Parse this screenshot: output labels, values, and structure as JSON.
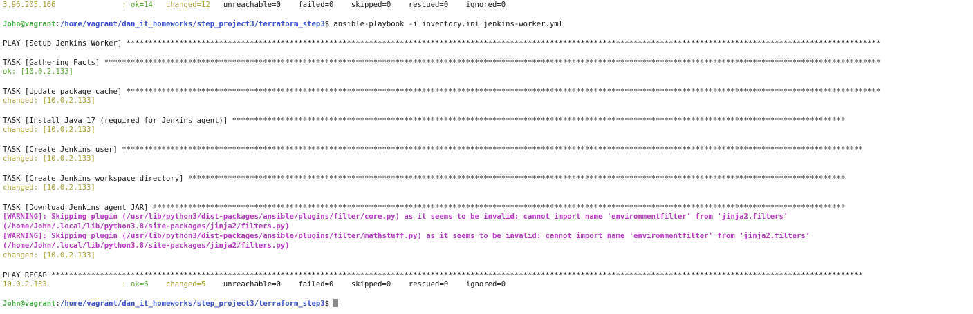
{
  "theme": {
    "background": "#ffffff",
    "default_text": "#1a1a1a",
    "ok_green": "#5aa52a",
    "changed_olive": "#a6a02e",
    "warning_magenta": "#b43ac0",
    "prompt_user_green": "#3fa53f",
    "prompt_path_blue": "#3b4fc8",
    "cursor_gray": "#8a8a8a"
  },
  "lines": [
    {
      "name": "recap-line-previous",
      "segments": [
        {
          "t": "3.96.205.166               : ",
          "c": "changed"
        },
        {
          "t": "ok=14",
          "c": "ok"
        },
        {
          "t": "   ",
          "c": "default"
        },
        {
          "t": "changed=12",
          "c": "changed"
        },
        {
          "t": "   unreachable=0    failed=0    skipped=0    rescued=0    ignored=0",
          "c": "default"
        }
      ]
    },
    {
      "name": "prompt-line-command",
      "segments": [
        {
          "t": "John@vagrant",
          "c": "user"
        },
        {
          "t": ":",
          "c": "default"
        },
        {
          "t": "/home/vagrant/dan_it_homeworks/step_project3/terraform_step3",
          "c": "path"
        },
        {
          "t": "$ ansible-playbook -i inventory.ini jenkins-worker.yml",
          "c": "default"
        }
      ]
    },
    {
      "name": "play-header",
      "segments": [
        {
          "t": "PLAY [Setup Jenkins Worker] ***************************************************************************************************************************************************************************",
          "c": "default"
        }
      ]
    },
    {
      "name": "task-gathering-facts",
      "segments": [
        {
          "t": "TASK [Gathering Facts] ********************************************************************************************************************************************************************************",
          "c": "default"
        }
      ]
    },
    {
      "name": "result-ok",
      "segments": [
        {
          "t": "ok: [10.0.2.133]",
          "c": "ok"
        }
      ]
    },
    {
      "name": "task-update-package-cache",
      "segments": [
        {
          "t": "TASK [Update package cache] ***************************************************************************************************************************************************************************",
          "c": "default"
        }
      ]
    },
    {
      "name": "result-changed",
      "segments": [
        {
          "t": "changed: [10.0.2.133]",
          "c": "changed"
        }
      ]
    },
    {
      "name": "task-install-java",
      "segments": [
        {
          "t": "TASK [Install Java 17 (required for Jenkins agent)] *******************************************************************************************************************************************",
          "c": "default"
        }
      ]
    },
    {
      "name": "result-changed",
      "segments": [
        {
          "t": "changed: [10.0.2.133]",
          "c": "changed"
        }
      ]
    },
    {
      "name": "task-create-jenkins-user",
      "segments": [
        {
          "t": "TASK [Create Jenkins user] ************************************************************************************************************************************************************************",
          "c": "default"
        }
      ]
    },
    {
      "name": "result-changed",
      "segments": [
        {
          "t": "changed: [10.0.2.133]",
          "c": "changed"
        }
      ]
    },
    {
      "name": "task-create-workspace-directory",
      "segments": [
        {
          "t": "TASK [Create Jenkins workspace directory] *****************************************************************************************************************************************************",
          "c": "default"
        }
      ]
    },
    {
      "name": "result-changed",
      "segments": [
        {
          "t": "changed: [10.0.2.133]",
          "c": "changed"
        }
      ]
    },
    {
      "name": "task-download-agent-jar",
      "segments": [
        {
          "t": "TASK [Download Jenkins agent JAR] *************************************************************************************************************************************************************",
          "c": "default"
        }
      ]
    },
    {
      "name": "warning-line",
      "segments": [
        {
          "t": "[WARNING]: Skipping plugin (/usr/lib/python3/dist-packages/ansible/plugins/filter/core.py) as it seems to be invalid: cannot import name 'environmentfilter' from 'jinja2.filters'",
          "c": "warn"
        }
      ]
    },
    {
      "name": "warning-line",
      "segments": [
        {
          "t": "(/home/John/.local/lib/python3.8/site-packages/jinja2/filters.py)",
          "c": "warn"
        }
      ]
    },
    {
      "name": "warning-line",
      "segments": [
        {
          "t": "[WARNING]: Skipping plugin (/usr/lib/python3/dist-packages/ansible/plugins/filter/mathstuff.py) as it seems to be invalid: cannot import name 'environmentfilter' from 'jinja2.filters'",
          "c": "warn"
        }
      ]
    },
    {
      "name": "warning-line",
      "segments": [
        {
          "t": "(/home/John/.local/lib/python3.8/site-packages/jinja2/filters.py)",
          "c": "warn"
        }
      ]
    },
    {
      "name": "result-changed",
      "segments": [
        {
          "t": "changed: [10.0.2.133]",
          "c": "changed"
        }
      ]
    },
    {
      "name": "play-recap-header",
      "segments": [
        {
          "t": "PLAY RECAP ****************************************************************************************************************************************************************************************",
          "c": "default"
        }
      ]
    },
    {
      "name": "recap-line",
      "segments": [
        {
          "t": "10.0.2.133                 : ",
          "c": "changed"
        },
        {
          "t": "ok=6",
          "c": "ok"
        },
        {
          "t": "    ",
          "c": "default"
        },
        {
          "t": "changed=5",
          "c": "changed"
        },
        {
          "t": "    unreachable=0    failed=0    skipped=0    rescued=0    ignored=0",
          "c": "default"
        }
      ]
    },
    {
      "name": "prompt-line-current",
      "cursor": true,
      "segments": [
        {
          "t": "John@vagrant",
          "c": "user"
        },
        {
          "t": ":",
          "c": "default"
        },
        {
          "t": "/home/vagrant/dan_it_homeworks/step_project3/terraform_step3",
          "c": "path"
        },
        {
          "t": "$ ",
          "c": "default"
        }
      ]
    }
  ]
}
